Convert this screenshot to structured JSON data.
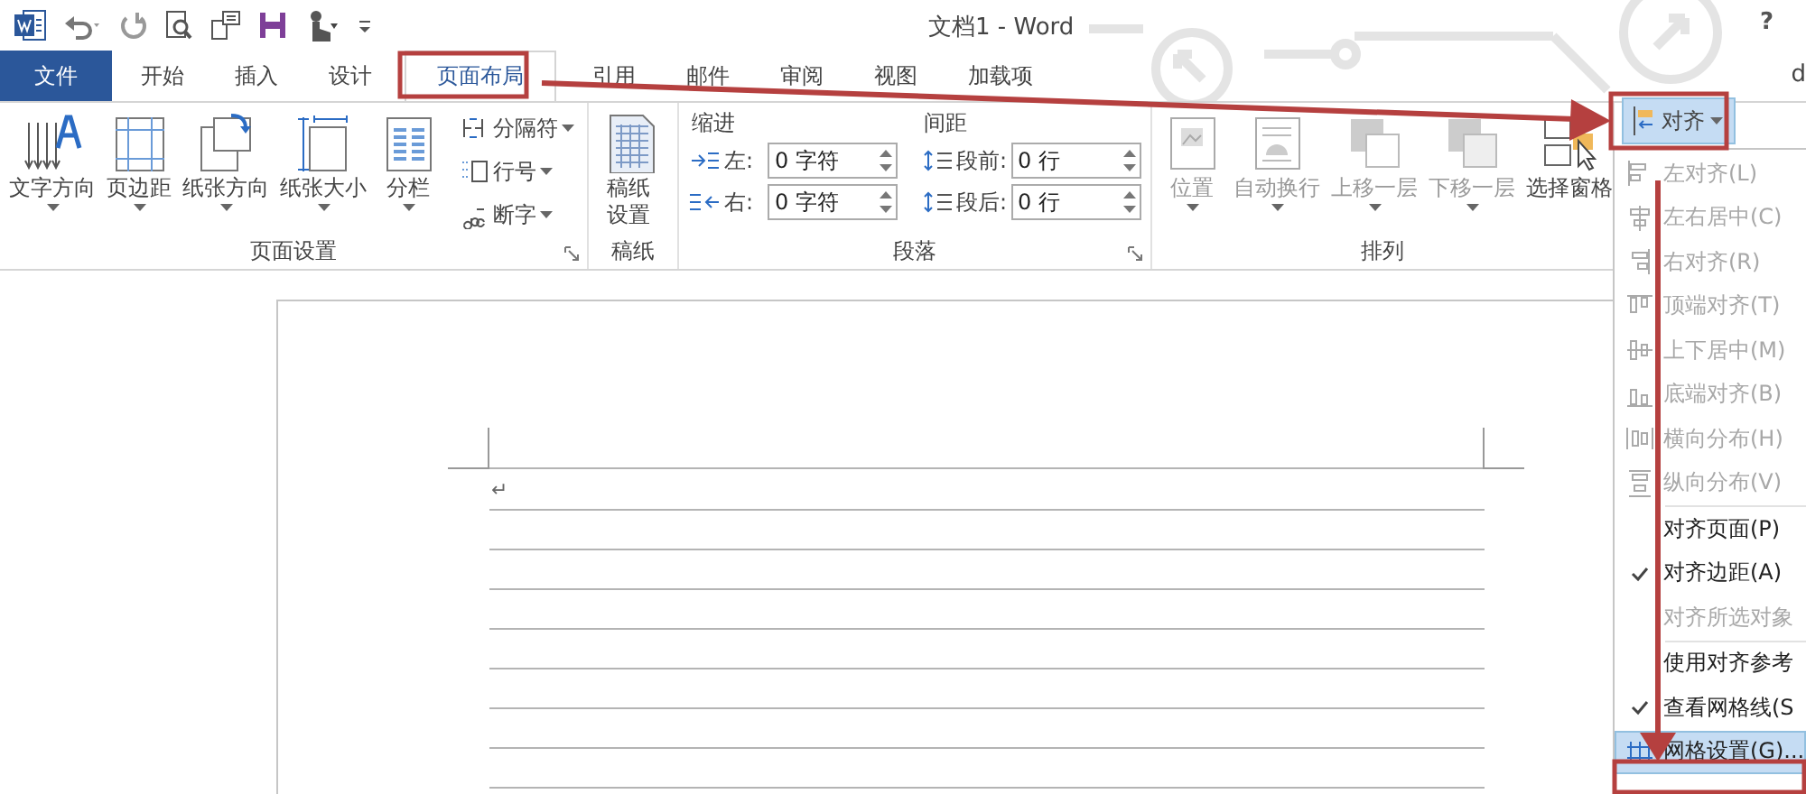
{
  "window": {
    "title": "文档1 - Word",
    "help": "?",
    "account": "d"
  },
  "tabs": [
    {
      "label": "文件",
      "kind": "file",
      "selected": false
    },
    {
      "label": "开始",
      "kind": "tab",
      "selected": false
    },
    {
      "label": "插入",
      "kind": "tab",
      "selected": false
    },
    {
      "label": "设计",
      "kind": "tab",
      "selected": false
    },
    {
      "label": "页面布局",
      "kind": "tab",
      "selected": true
    },
    {
      "label": "引用",
      "kind": "tab",
      "selected": false
    },
    {
      "label": "邮件",
      "kind": "tab",
      "selected": false
    },
    {
      "label": "审阅",
      "kind": "tab",
      "selected": false
    },
    {
      "label": "视图",
      "kind": "tab",
      "selected": false
    },
    {
      "label": "加载项",
      "kind": "tab",
      "selected": false
    }
  ],
  "ribbon": {
    "page_setup": {
      "label": "页面设置",
      "launcher": true,
      "large_buttons": [
        {
          "label": "文字方向",
          "dropdown": true,
          "disabled": false
        },
        {
          "label": "页边距",
          "dropdown": true,
          "disabled": false
        },
        {
          "label": "纸张方向",
          "dropdown": true,
          "disabled": false
        },
        {
          "label": "纸张大小",
          "dropdown": true,
          "disabled": false
        },
        {
          "label": "分栏",
          "dropdown": true,
          "disabled": false
        }
      ],
      "small_buttons": [
        {
          "label": "分隔符",
          "dropdown": true
        },
        {
          "label": "行号",
          "dropdown": true
        },
        {
          "label": "断字",
          "dropdown": true
        }
      ]
    },
    "manuscript": {
      "label": "稿纸",
      "launcher": false,
      "large_buttons": [
        {
          "label": "稿纸设置",
          "dropdown": false,
          "disabled": false
        }
      ]
    },
    "paragraph": {
      "label": "段落",
      "launcher": true,
      "columns": [
        {
          "heading": "缩进",
          "rows": [
            {
              "label": "左:",
              "value": "0 字符"
            },
            {
              "label": "右:",
              "value": "0 字符"
            }
          ]
        },
        {
          "heading": "间距",
          "rows": [
            {
              "label": "段前:",
              "value": "0 行"
            },
            {
              "label": "段后:",
              "value": "0 行"
            }
          ]
        }
      ]
    },
    "arrange": {
      "label": "排列",
      "launcher": false,
      "large_buttons": [
        {
          "label": "位置",
          "dropdown": true,
          "disabled": true
        },
        {
          "label": "自动换行",
          "dropdown": true,
          "disabled": true
        },
        {
          "label": "上移一层",
          "dropdown": true,
          "disabled": true
        },
        {
          "label": "下移一层",
          "dropdown": true,
          "disabled": true
        },
        {
          "label": "选择窗格",
          "dropdown": false,
          "disabled": false
        }
      ]
    },
    "align_button": {
      "label": "对齐",
      "open": true
    }
  },
  "align_menu": [
    {
      "label": "左对齐(L)",
      "disabled": true,
      "checked": false,
      "selected": false,
      "separator": false
    },
    {
      "label": "左右居中(C)",
      "disabled": true,
      "checked": false,
      "selected": false,
      "separator": false
    },
    {
      "label": "右对齐(R)",
      "disabled": true,
      "checked": false,
      "selected": false,
      "separator": false
    },
    {
      "label": "顶端对齐(T)",
      "disabled": true,
      "checked": false,
      "selected": false,
      "separator": false
    },
    {
      "label": "上下居中(M)",
      "disabled": true,
      "checked": false,
      "selected": false,
      "separator": false
    },
    {
      "label": "底端对齐(B)",
      "disabled": true,
      "checked": false,
      "selected": false,
      "separator": false
    },
    {
      "label": "横向分布(H)",
      "disabled": true,
      "checked": false,
      "selected": false,
      "separator": false
    },
    {
      "label": "纵向分布(V)",
      "disabled": true,
      "checked": false,
      "selected": false,
      "separator": false
    },
    {
      "label": "对齐页面(P)",
      "disabled": false,
      "checked": false,
      "selected": false,
      "separator": true
    },
    {
      "label": "对齐边距(A)",
      "disabled": false,
      "checked": true,
      "selected": false,
      "separator": false
    },
    {
      "label": "对齐所选对象",
      "disabled": true,
      "checked": false,
      "selected": false,
      "separator": false
    },
    {
      "label": "使用对齐参考",
      "disabled": false,
      "checked": false,
      "selected": false,
      "separator": true
    },
    {
      "label": "查看网格线(S",
      "disabled": false,
      "checked": true,
      "selected": false,
      "separator": false
    },
    {
      "label": "网格设置(G)...",
      "disabled": false,
      "checked": false,
      "selected": true,
      "separator": false
    }
  ],
  "document": {
    "paragraph_mark": "↵"
  }
}
